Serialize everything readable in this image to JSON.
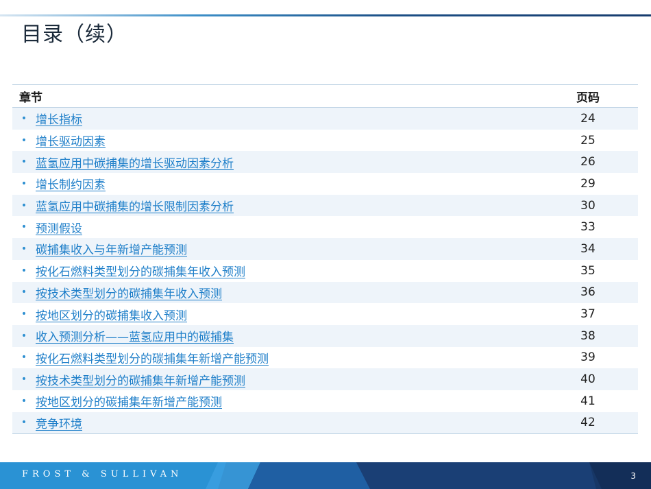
{
  "slide": {
    "title": "目录（续）",
    "page_number": "3"
  },
  "toc": {
    "header_chapter": "章节",
    "header_page": "页码",
    "items": [
      {
        "label": "增长指标",
        "page": "24"
      },
      {
        "label": "增长驱动因素",
        "page": "25"
      },
      {
        "label": "蓝氢应用中碳捕集的增长驱动因素分析",
        "page": "26"
      },
      {
        "label": "增长制约因素",
        "page": "29"
      },
      {
        "label": "蓝氢应用中碳捕集的增长限制因素分析",
        "page": "30"
      },
      {
        "label": "预测假设",
        "page": "33"
      },
      {
        "label": "碳捕集收入与年新增产能预测",
        "page": "34"
      },
      {
        "label": "按化石燃料类型划分的碳捕集年收入预测",
        "page": "35"
      },
      {
        "label": "按技术类型划分的碳捕集年收入预测",
        "page": "36"
      },
      {
        "label": "按地区划分的碳捕集收入预测",
        "page": "37"
      },
      {
        "label": "收入预测分析——蓝氢应用中的碳捕集",
        "page": "38"
      },
      {
        "label": "按化石燃料类型划分的碳捕集年新增产能预测",
        "page": "39"
      },
      {
        "label": "按技术类型划分的碳捕集年新增产能预测",
        "page": "40"
      },
      {
        "label": "按地区划分的碳捕集年新增产能预测",
        "page": "41"
      },
      {
        "label": "竞争环境",
        "page": "42"
      }
    ]
  },
  "footer": {
    "logo_text": "FROST & SULLIVAN"
  },
  "colors": {
    "link": "#1f7fc9",
    "row_shade": "#eef4fa",
    "footer_dark": "#173766",
    "footer_light": "#2a8fd0"
  }
}
